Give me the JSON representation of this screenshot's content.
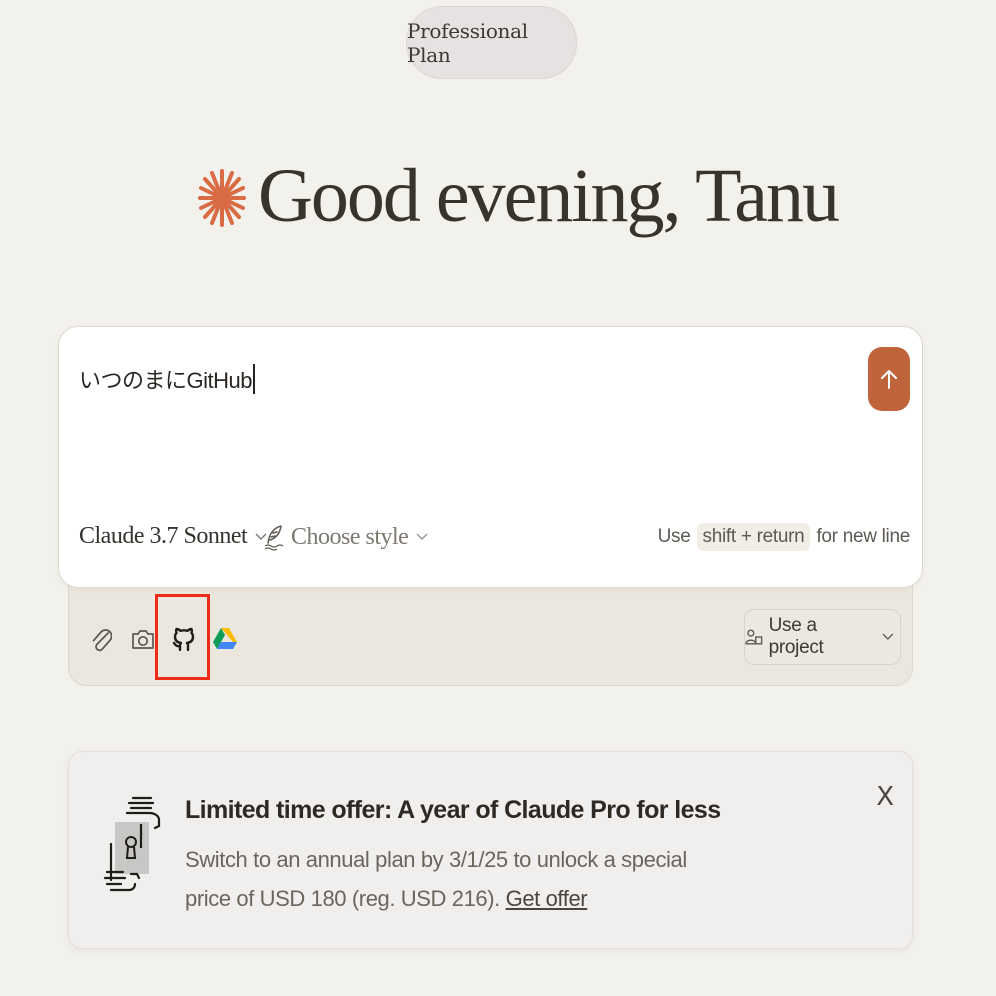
{
  "header": {
    "plan_label": "Professional Plan"
  },
  "greeting": {
    "text": "Good evening, Tanu",
    "spark_color": "#d96b45"
  },
  "composer": {
    "input_value": "いつのまにGitHub",
    "send_icon": "arrow-up-icon",
    "model_label": "Claude 3.7 Sonnet",
    "style_label": "Choose style",
    "hint_prefix": "Use",
    "hint_keys": "shift + return",
    "hint_suffix": "for new line",
    "accent_color": "#c0643c"
  },
  "tray": {
    "icons": [
      "paperclip-icon",
      "camera-icon",
      "github-icon",
      "google-drive-icon"
    ],
    "project_label": "Use a project"
  },
  "offer": {
    "title": "Limited time offer: A year of Claude Pro for less",
    "body": "Switch to an annual plan by 3/1/25 to unlock a special price of USD 180 (reg. USD 216).",
    "link_label": "Get offer",
    "close_label": "X"
  }
}
